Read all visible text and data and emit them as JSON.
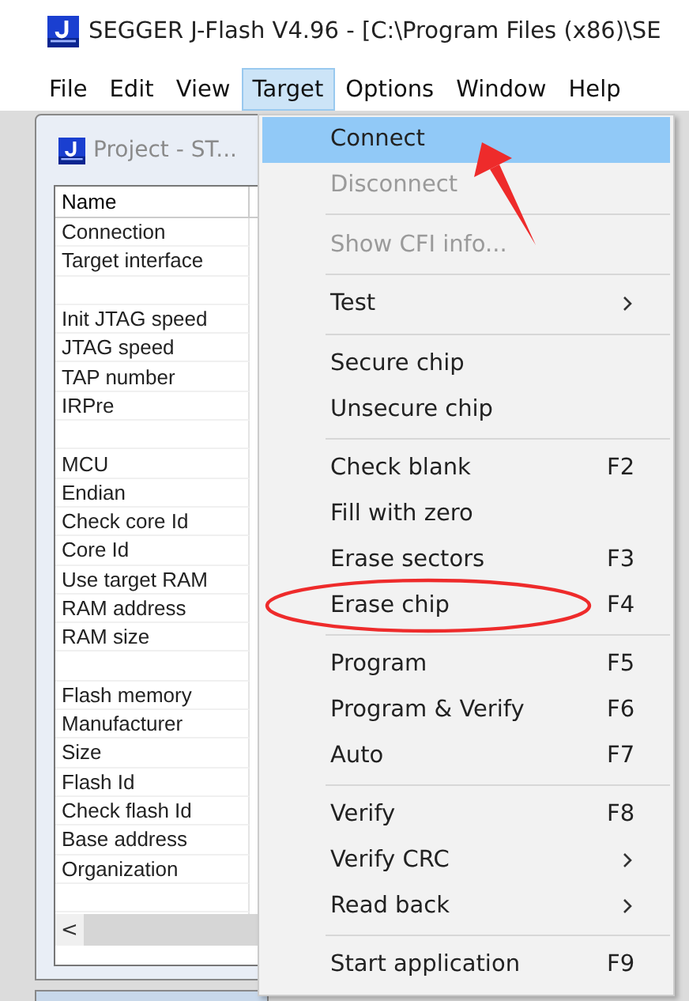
{
  "window": {
    "title": "SEGGER J-Flash V4.96 - [C:\\Program Files (x86)\\SE"
  },
  "menu_bar": [
    {
      "label": "File",
      "selected": false
    },
    {
      "label": "Edit",
      "selected": false
    },
    {
      "label": "View",
      "selected": false
    },
    {
      "label": "Target",
      "selected": true
    },
    {
      "label": "Options",
      "selected": false
    },
    {
      "label": "Window",
      "selected": false
    },
    {
      "label": "Help",
      "selected": false
    }
  ],
  "project_window": {
    "title": "Project - ST...",
    "column_header": "Name",
    "scroll_left": "<",
    "groups": [
      [
        "Connection",
        "Target interface"
      ],
      [
        "Init JTAG speed",
        "JTAG speed",
        "TAP number",
        "IRPre"
      ],
      [
        "MCU",
        "Endian",
        "Check core Id",
        "Core Id",
        "Use target RAM",
        "RAM address",
        "RAM size"
      ],
      [
        "Flash memory",
        "Manufacturer",
        "Size",
        "Flash Id",
        "Check flash Id",
        "Base address",
        "Organization"
      ]
    ]
  },
  "target_menu": [
    {
      "kind": "item",
      "label": "Connect",
      "selected": true,
      "disabled": false,
      "submenu": false
    },
    {
      "kind": "item",
      "label": "Disconnect",
      "selected": false,
      "disabled": true,
      "submenu": false
    },
    {
      "kind": "separator"
    },
    {
      "kind": "item",
      "label": "Show CFI info...",
      "selected": false,
      "disabled": true,
      "submenu": false
    },
    {
      "kind": "separator"
    },
    {
      "kind": "item",
      "label": "Test",
      "selected": false,
      "disabled": false,
      "submenu": true
    },
    {
      "kind": "separator"
    },
    {
      "kind": "item",
      "label": "Secure chip",
      "selected": false,
      "disabled": false,
      "submenu": false
    },
    {
      "kind": "item",
      "label": "Unsecure chip",
      "selected": false,
      "disabled": false,
      "submenu": false
    },
    {
      "kind": "separator"
    },
    {
      "kind": "item",
      "label": "Check blank",
      "shortcut": "F2",
      "selected": false,
      "disabled": false,
      "submenu": false
    },
    {
      "kind": "item",
      "label": "Fill with zero",
      "selected": false,
      "disabled": false,
      "submenu": false
    },
    {
      "kind": "item",
      "label": "Erase sectors",
      "shortcut": "F3",
      "selected": false,
      "disabled": false,
      "submenu": false
    },
    {
      "kind": "item",
      "label": "Erase chip",
      "shortcut": "F4",
      "selected": false,
      "disabled": false,
      "submenu": false
    },
    {
      "kind": "separator"
    },
    {
      "kind": "item",
      "label": "Program",
      "shortcut": "F5",
      "selected": false,
      "disabled": false,
      "submenu": false
    },
    {
      "kind": "item",
      "label": "Program & Verify",
      "shortcut": "F6",
      "selected": false,
      "disabled": false,
      "submenu": false
    },
    {
      "kind": "item",
      "label": "Auto",
      "shortcut": "F7",
      "selected": false,
      "disabled": false,
      "submenu": false
    },
    {
      "kind": "separator"
    },
    {
      "kind": "item",
      "label": "Verify",
      "shortcut": "F8",
      "selected": false,
      "disabled": false,
      "submenu": false
    },
    {
      "kind": "item",
      "label": "Verify CRC",
      "selected": false,
      "disabled": false,
      "submenu": true
    },
    {
      "kind": "item",
      "label": "Read back",
      "selected": false,
      "disabled": false,
      "submenu": true
    },
    {
      "kind": "separator"
    },
    {
      "kind": "item",
      "label": "Start application",
      "shortcut": "F9",
      "selected": false,
      "disabled": false,
      "submenu": false
    }
  ]
}
